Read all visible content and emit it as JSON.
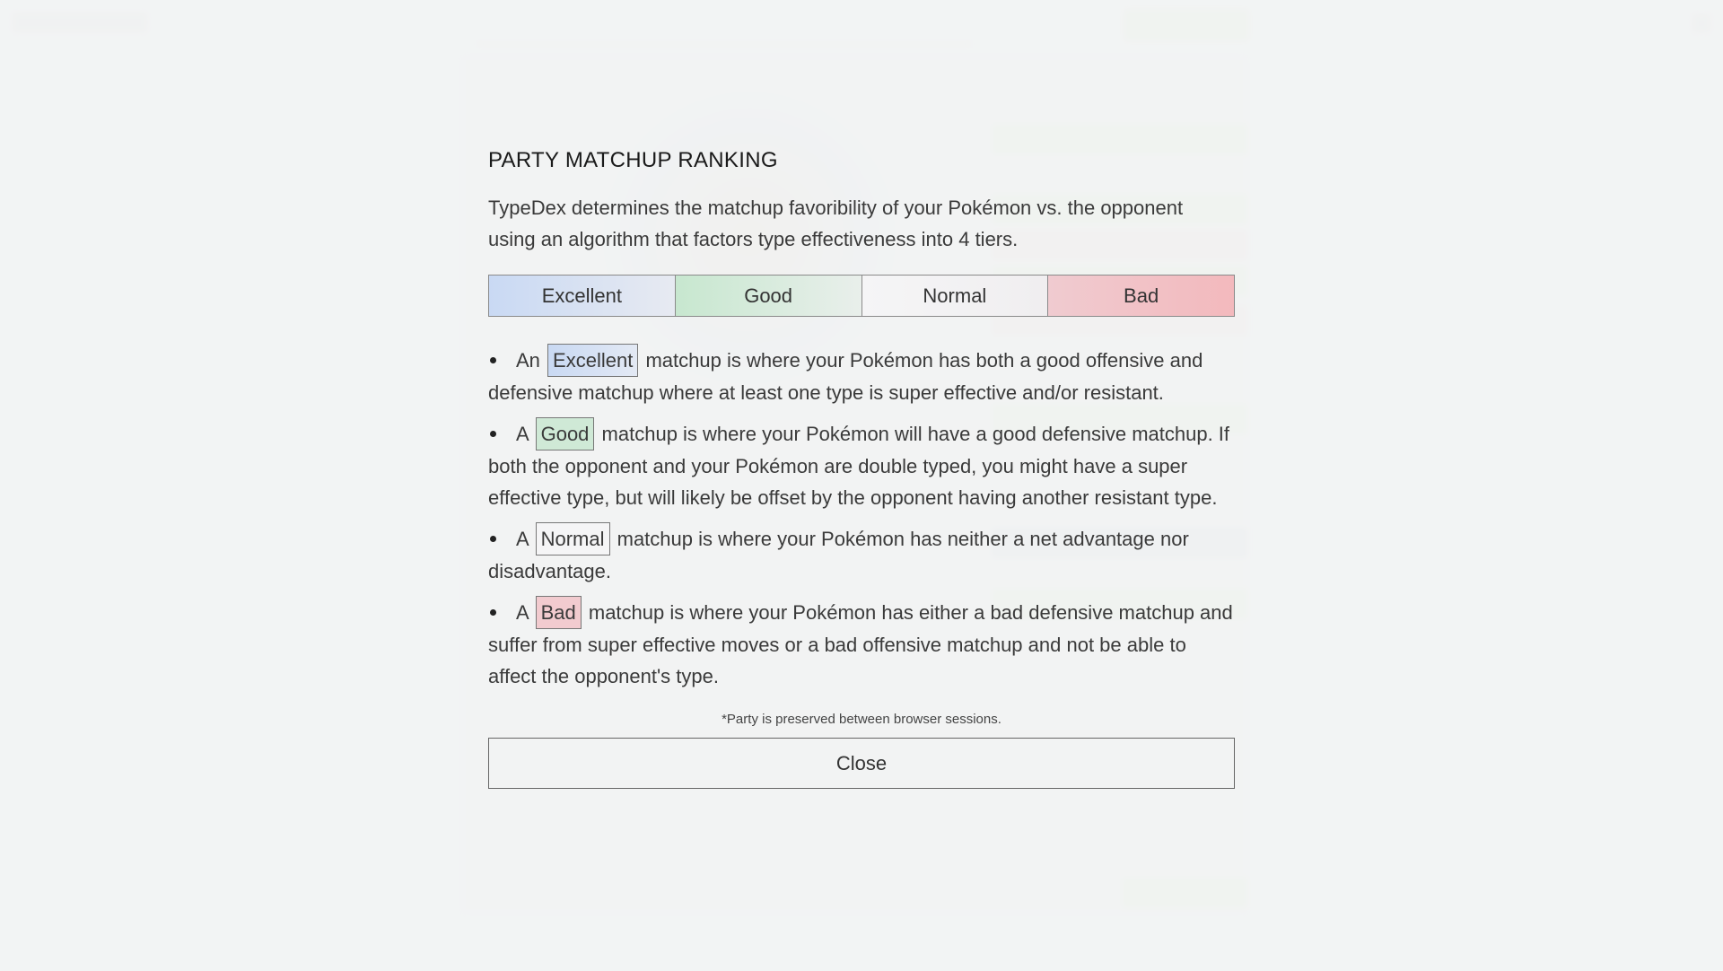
{
  "modal": {
    "title": "PARTY MATCHUP RANKING",
    "intro": "TypeDex determines the matchup favoribility of your Pokémon vs. the opponent using an algorithm that factors type effectiveness into 4 tiers.",
    "tiers": [
      "Excellent",
      "Good",
      "Normal",
      "Bad"
    ],
    "descriptions": [
      {
        "prefix": "An",
        "tag": "Excellent",
        "text": "matchup is where your Pokémon has both a good offensive and defensive matchup where at least one type is super effective and/or resistant."
      },
      {
        "prefix": "A",
        "tag": "Good",
        "text": "matchup is where your Pokémon will have a good defensive matchup. If both the opponent and your Pokémon are double typed, you might have a super effective type, but will likely be offset by the opponent having another resistant type."
      },
      {
        "prefix": "A",
        "tag": "Normal",
        "text": "matchup is where your Pokémon has neither a net advantage nor disadvantage."
      },
      {
        "prefix": "A",
        "tag": "Bad",
        "text": "matchup is where your Pokémon has either a bad defensive matchup and suffer from super effective moves or a bad offensive matchup and not be able to affect the opponent's type."
      }
    ],
    "footnote": "*Party is preserved between browser sessions.",
    "close_label": "Close"
  },
  "colors": {
    "excellent": "#c9d9f3",
    "good": "#c7e7cf",
    "normal": "#f5f5f6",
    "bad": "#f2cbcf"
  }
}
